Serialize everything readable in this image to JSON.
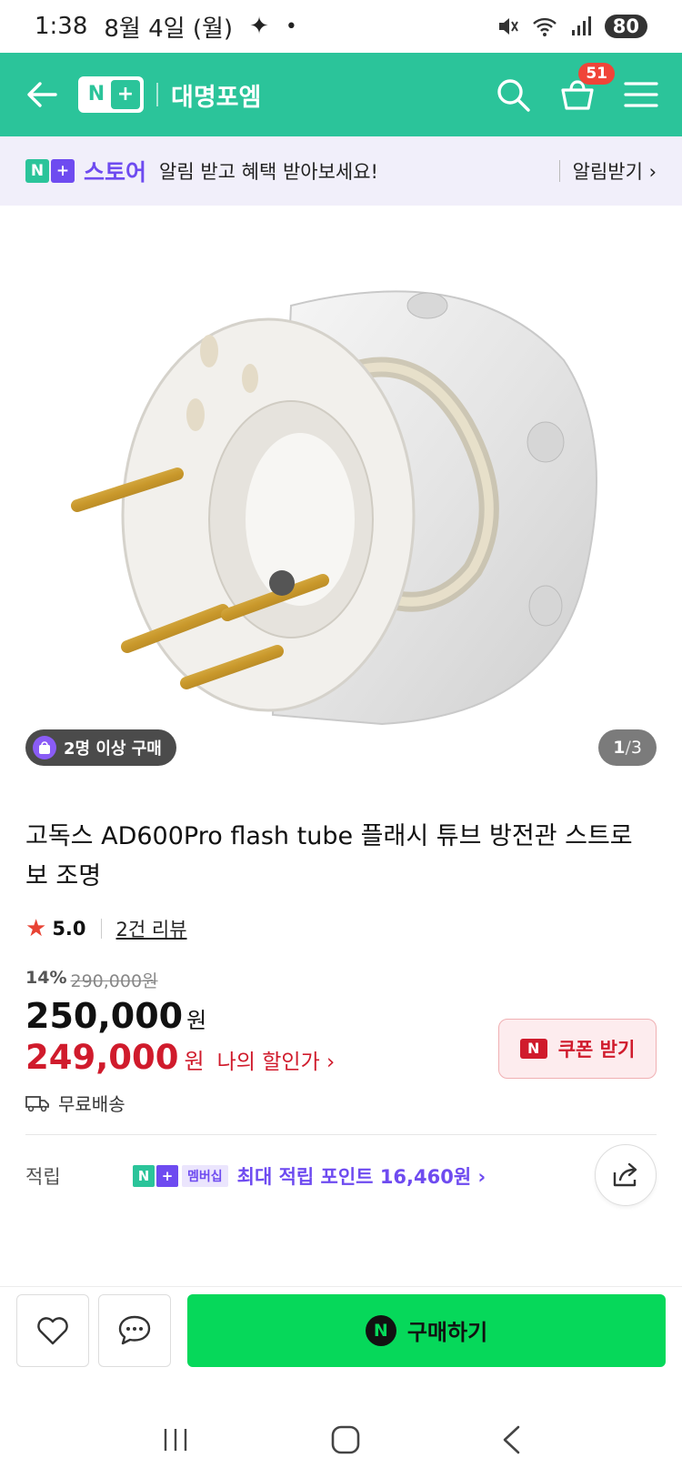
{
  "status_bar": {
    "time": "1:38",
    "date": "8월 4일 (월)",
    "battery": "80"
  },
  "header": {
    "logo_n": "N",
    "logo_plus": "+",
    "store_name": "대명포엠",
    "cart_count": "51",
    "accent_color": "#2bc49a"
  },
  "notice": {
    "brand_n": "N",
    "brand_plus": "+",
    "brand_word": "스토어",
    "text": "알림 받고 혜택 받아보세요!",
    "action_label": "알림받기 ›"
  },
  "gallery": {
    "bundle_badge": "2명 이상 구매",
    "current_page": "1",
    "separator": "/",
    "total_pages": "3"
  },
  "product": {
    "title": "고독스 AD600Pro flash tube 플래시 튜브 방전관 스트로보 조명",
    "rating": "5.0",
    "review_link": "2건 리뷰",
    "discount_rate": "14%",
    "original_price": "290,000원",
    "price": "250,000",
    "price_unit": "원",
    "my_price": "249,000",
    "my_price_unit": "원",
    "my_price_label": "나의 할인가 ›",
    "coupon_button": "쿠폰 받기",
    "coupon_n": "N",
    "shipping": "무료배송",
    "sale_color": "#d01b2c"
  },
  "points": {
    "label": "적립",
    "badge_n": "N",
    "badge_plus": "+",
    "badge_member": "멤버십",
    "text": "최대 적립 포인트 16,460원 ›"
  },
  "bottom_bar": {
    "buy_n": "N",
    "buy_label": "구매하기",
    "buy_color": "#06d85a"
  }
}
